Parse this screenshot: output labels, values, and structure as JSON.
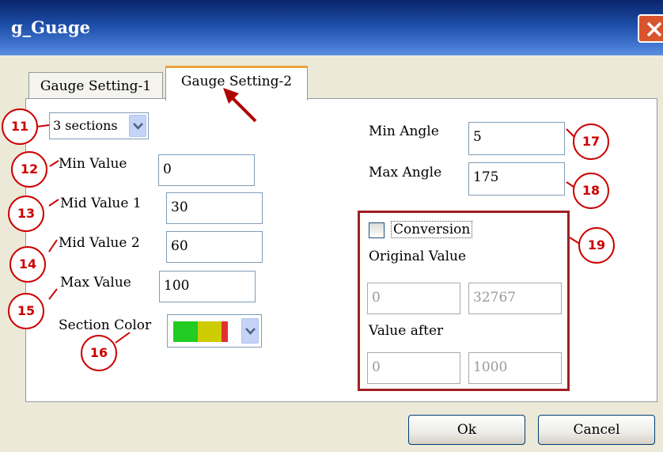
{
  "window": {
    "title": "g_Guage"
  },
  "tabs": [
    {
      "label": "Gauge Setting-1",
      "active": false
    },
    {
      "label": "Gauge Setting-2",
      "active": true
    }
  ],
  "sections_select": {
    "value": "3 sections"
  },
  "fields": {
    "min_value": {
      "label": "Min Value",
      "value": "0"
    },
    "mid_value_1": {
      "label": "Mid Value 1",
      "value": "30"
    },
    "mid_value_2": {
      "label": "Mid Value 2",
      "value": "60"
    },
    "max_value": {
      "label": "Max Value",
      "value": "100"
    },
    "section_color": {
      "label": "Section Color"
    },
    "min_angle": {
      "label": "Min Angle",
      "value": "5"
    },
    "max_angle": {
      "label": "Max Angle",
      "value": "175"
    }
  },
  "section_colors": [
    "#22cc22",
    "#cccc00",
    "#e03030"
  ],
  "conversion": {
    "label": "Conversion",
    "checked": false,
    "original_label": "Original Value",
    "original_min": "0",
    "original_max": "32767",
    "after_label": "Value after",
    "after_min": "0",
    "after_max": "1000"
  },
  "buttons": {
    "ok": "Ok",
    "cancel": "Cancel"
  },
  "annotations": [
    "11",
    "12",
    "13",
    "14",
    "15",
    "16",
    "17",
    "18",
    "19"
  ],
  "accent_colors": {
    "annotation": "#cc0000",
    "highlight_box": "#a02020",
    "tab_active_top": "#e8a33d"
  }
}
